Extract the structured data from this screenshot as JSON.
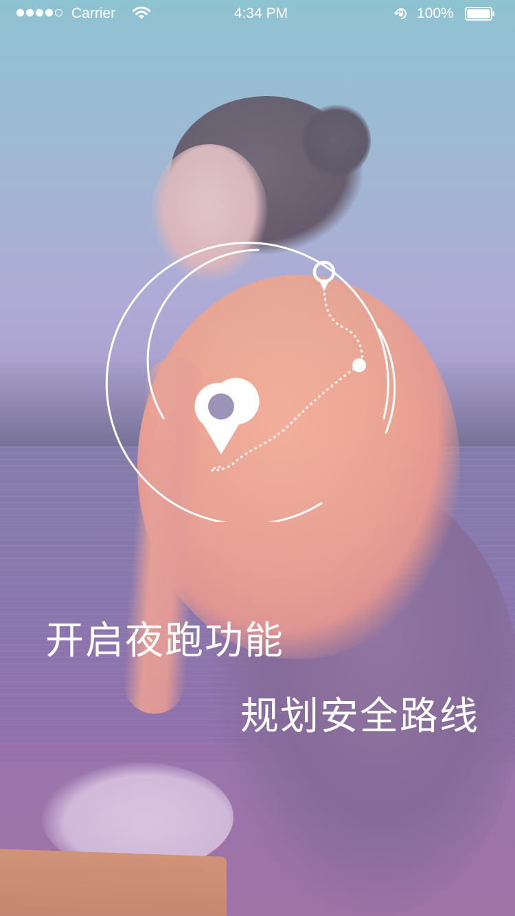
{
  "status_bar": {
    "signal_bars_filled": 4,
    "signal_bars_total": 5,
    "carrier": "Carrier",
    "time": "4:34 PM",
    "battery_percent": "100%",
    "battery_level": 1.0
  },
  "route": {
    "start_marker": "map-pin-icon",
    "end_marker": "map-pin-icon"
  },
  "feature": {
    "line_1": "开启夜跑功能",
    "line_2": "规划安全路线"
  },
  "colors": {
    "text": "#ffffff",
    "accent_sky": "#8fc1cf",
    "accent_purple": "#8a6ca6"
  }
}
